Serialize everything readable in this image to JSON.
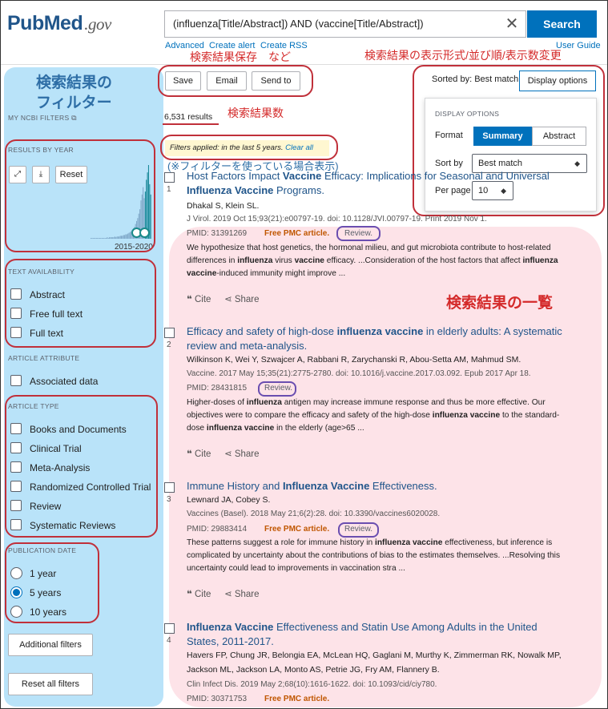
{
  "header": {
    "logo_main": "PubMed",
    "logo_suffix": ".gov",
    "search_query": "(influenza[Title/Abstract]) AND (vaccine[Title/Abstract])",
    "search_label": "Search",
    "links": {
      "advanced": "Advanced",
      "create_alert": "Create alert",
      "create_rss": "Create RSS",
      "user_guide": "User Guide"
    }
  },
  "annotations": {
    "filters_heading_1": "検索結果の",
    "filters_heading_2": "フィルター",
    "save_etc": "検索結果保存　など",
    "display_change": "検索結果の表示形式/並び順/表示数変更",
    "result_count": "検索結果数",
    "filter_note": "(※フィルターを使っている場合表示)",
    "result_list": "検索結果の一覧"
  },
  "sidebar": {
    "my_ncbi_filters": "MY NCBI FILTERS",
    "results_by_year": "RESULTS BY YEAR",
    "reset": "Reset",
    "year_range": "2015-2020",
    "text_availability": {
      "heading": "TEXT AVAILABILITY",
      "items": [
        "Abstract",
        "Free full text",
        "Full text"
      ]
    },
    "article_attribute": {
      "heading": "ARTICLE ATTRIBUTE",
      "items": [
        "Associated data"
      ]
    },
    "article_type": {
      "heading": "ARTICLE TYPE",
      "items": [
        "Books and Documents",
        "Clinical Trial",
        "Meta-Analysis",
        "Randomized Controlled Trial",
        "Review",
        "Systematic Reviews"
      ]
    },
    "publication_date": {
      "heading": "PUBLICATION DATE",
      "items": [
        "1 year",
        "5 years",
        "10 years"
      ],
      "selected": "5 years"
    },
    "additional_filters": "Additional filters",
    "reset_all": "Reset all filters"
  },
  "toolbar": {
    "save": "Save",
    "email": "Email",
    "send_to": "Send to",
    "sorted_by": "Sorted by: Best match",
    "display_options": "Display options"
  },
  "results_count": "6,531 results",
  "filters_applied": {
    "text": "Filters applied: in the last 5 years.",
    "clear": "Clear all"
  },
  "display_options": {
    "heading": "DISPLAY OPTIONS",
    "format_label": "Format",
    "format_summary": "Summary",
    "format_abstract": "Abstract",
    "sort_label": "Sort by",
    "sort_value": "Best match",
    "per_page_label": "Per page",
    "per_page_value": "10"
  },
  "results": [
    {
      "num": "1",
      "title_a": "Host Factors Impact ",
      "title_b": "Vaccine",
      "title_c": " Efficacy: Implications for Seasonal and Universal",
      "title_d": "Influenza Vaccine",
      "title_e": " Programs.",
      "authors": "Dhakal S, Klein SL.",
      "journal": "J Virol. 2019 Oct 15;93(21):e00797-19. doi: 10.1128/JVI.00797-19. Print 2019 Nov 1.",
      "pmid": "PMID: 31391269",
      "pmc": "Free PMC article.",
      "review": "Review.",
      "abs1a": "We hypothesize that host genetics, the hormonal milieu, and gut microbiota contribute to host-related",
      "abs2a": "differences in ",
      "abs2b": "influenza",
      "abs2c": " virus ",
      "abs2d": "vaccine",
      "abs2e": " efficacy. ...Consideration of the host factors that affect ",
      "abs2f": "influenza",
      "abs3a": "vaccine",
      "abs3b": "-induced immunity might improve ..."
    },
    {
      "num": "2",
      "title_a": "Efficacy and safety of high-dose ",
      "title_b": "influenza vaccine",
      "title_c": " in elderly adults: A systematic",
      "title_d": "review and meta-analysis.",
      "authors": "Wilkinson K, Wei Y, Szwajcer A, Rabbani R, Zarychanski R, Abou-Setta AM, Mahmud SM.",
      "journal": "Vaccine. 2017 May 15;35(21):2775-2780. doi: 10.1016/j.vaccine.2017.03.092. Epub 2017 Apr 18.",
      "pmid": "PMID: 28431815",
      "review": "Review.",
      "abs1a": "Higher-doses of ",
      "abs1b": "influenza",
      "abs1c": " antigen may increase immune response and thus be more effective. Our",
      "abs2a": "objectives were to compare the efficacy and safety of the high-dose ",
      "abs2b": "influenza vaccine",
      "abs2c": " to the standard-",
      "abs3a": "dose ",
      "abs3b": "influenza vaccine",
      "abs3c": " in the elderly (age>65 ..."
    },
    {
      "num": "3",
      "title_a": "Immune History and ",
      "title_b": "Influenza Vaccine",
      "title_c": " Effectiveness.",
      "authors": "Lewnard JA, Cobey S.",
      "journal": "Vaccines (Basel). 2018 May 21;6(2):28. doi: 10.3390/vaccines6020028.",
      "pmid": "PMID: 29883414",
      "pmc": "Free PMC article.",
      "review": "Review.",
      "abs1a": "These patterns suggest a role for immune history in ",
      "abs1b": "influenza vaccine",
      "abs1c": " effectiveness, but inference is",
      "abs2a": "complicated by uncertainty about the contributions of bias to the estimates themselves. ...Resolving this",
      "abs3a": "uncertainty could lead to improvements in vaccination stra ..."
    },
    {
      "num": "4",
      "title_a": "Influenza Vaccine",
      "title_b": " Effectiveness and Statin Use Among Adults in the United",
      "title_c": "States, 2011-2017.",
      "authors1": "Havers FP, Chung JR, Belongia EA, McLean HQ, Gaglani M, Murthy K, Zimmerman RK, Nowalk MP,",
      "authors2": "Jackson ML, Jackson LA, Monto AS, Petrie JG, Fry AM, Flannery B.",
      "journal": "Clin Infect Dis. 2019 May 2;68(10):1616-1622. doi: 10.1093/cid/ciy780.",
      "pmid": "PMID: 30371753",
      "pmc": "Free PMC article."
    }
  ],
  "actions": {
    "cite": "Cite",
    "share": "Share"
  },
  "histogram": {
    "values": [
      1,
      1,
      1,
      1,
      1,
      1,
      1,
      1,
      1,
      1,
      1,
      1,
      1,
      1,
      1,
      2,
      1,
      2,
      2,
      2,
      2,
      2,
      3,
      2,
      3,
      3,
      3,
      4,
      4,
      4,
      5,
      5,
      6,
      6,
      7,
      8,
      9,
      10,
      12,
      14,
      16,
      20,
      24,
      28,
      34,
      40,
      52,
      60,
      70,
      55,
      64,
      80,
      90,
      100,
      74,
      60
    ]
  }
}
